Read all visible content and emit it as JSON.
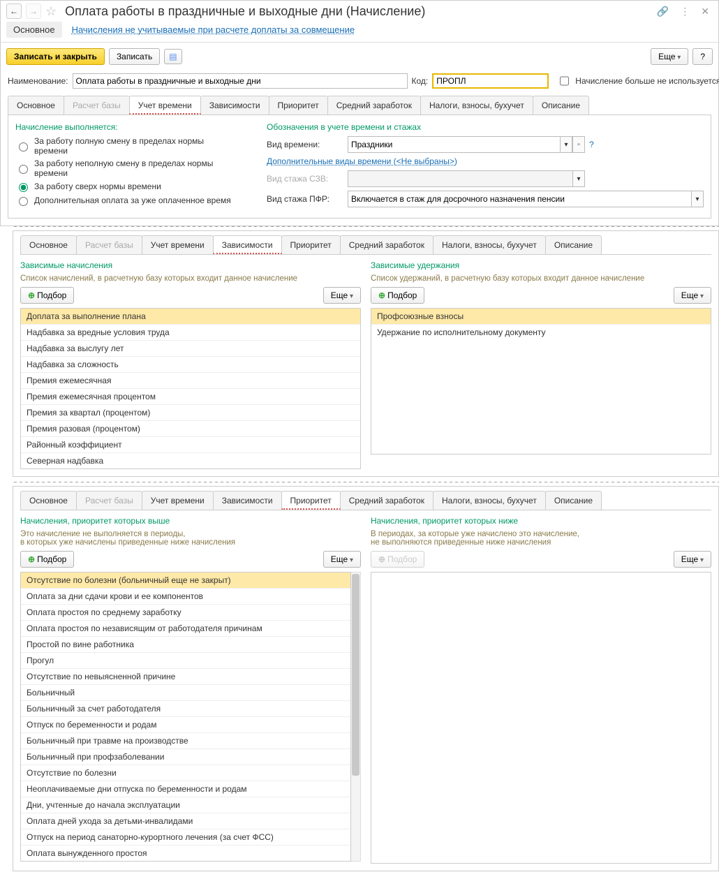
{
  "header": {
    "title": "Оплата работы в праздничные и выходные дни (Начисление)"
  },
  "subnav": {
    "main": "Основное",
    "link": "Начисления не учитываемые при расчете доплаты за совмещение"
  },
  "toolbar": {
    "save_close": "Записать и закрыть",
    "save": "Записать",
    "more": "Еще",
    "help": "?"
  },
  "form": {
    "name_label": "Наименование:",
    "name_value": "Оплата работы в праздничные и выходные дни",
    "code_label": "Код:",
    "code_value": "ПРОПЛ",
    "not_used_label": "Начисление больше не используется"
  },
  "main_tabs": {
    "t1": "Основное",
    "t2": "Расчет базы",
    "t3": "Учет времени",
    "t4": "Зависимости",
    "t5": "Приоритет",
    "t6": "Средний заработок",
    "t7": "Налоги, взносы, бухучет",
    "t8": "Описание"
  },
  "time_tab": {
    "left_title": "Начисление выполняется:",
    "r1": "За работу полную смену в пределах нормы времени",
    "r2": "За работу неполную смену в пределах нормы времени",
    "r3": "За работу сверх нормы времени",
    "r4": "Дополнительная оплата за уже оплаченное время",
    "right_title": "Обозначения в учете времени и стажах",
    "f1_label": "Вид времени:",
    "f1_value": "Праздники",
    "extra_link": "Дополнительные виды времени (<Не выбраны>)",
    "f2_label": "Вид стажа СЗВ:",
    "f2_value": "",
    "f3_label": "Вид стажа ПФР:",
    "f3_value": "Включается в стаж для досрочного назначения пенсии"
  },
  "deps_panel": {
    "left_title": "Зависимые начисления",
    "left_hint": "Список начислений, в расчетную базу которых входит данное начисление",
    "right_title": "Зависимые удержания",
    "right_hint": "Список удержаний, в расчетную базу которых входит данное начисление",
    "pick": "Подбор",
    "more": "Еще",
    "left_rows": [
      "Доплата за выполнение плана",
      "Надбавка за вредные условия труда",
      "Надбавка за выслугу лет",
      "Надбавка за сложность",
      "Премия ежемесячная",
      "Премия ежемесячная процентом",
      "Премия за квартал (процентом)",
      "Премия разовая (процентом)",
      "Районный коэффициент",
      "Северная надбавка"
    ],
    "right_rows": [
      "Профсоюзные взносы",
      "Удержание по исполнительному документу"
    ]
  },
  "prio_panel": {
    "left_title": "Начисления, приоритет которых выше",
    "left_hint1": "Это начисление не выполняется в периоды,",
    "left_hint2": "в которых уже начислены приведенные ниже начисления",
    "right_title": "Начисления, приоритет которых ниже",
    "right_hint1": "В периодах, за которые уже начислено это начисление,",
    "right_hint2": "не выполняются приведенные ниже начисления",
    "pick": "Подбор",
    "more": "Еще",
    "left_rows": [
      "Отсутствие по болезни (больничный еще не закрыт)",
      "Оплата за дни сдачи крови и ее компонентов",
      "Оплата простоя по среднему заработку",
      "Оплата простоя по независящим от работодателя причинам",
      "Простой по вине работника",
      "Прогул",
      "Отсутствие по невыясненной причине",
      "Больничный",
      "Больничный за счет работодателя",
      "Отпуск по беременности и родам",
      "Больничный при травме на производстве",
      "Больничный при профзаболевании",
      "Отсутствие по болезни",
      "Неоплачиваемые дни отпуска по беременности и родам",
      "Дни, учтенные до начала эксплуатации",
      "Оплата дней ухода за детьми-инвалидами",
      "Отпуск на период санаторно-курортного лечения (за счет ФСС)",
      "Оплата вынужденного простоя"
    ]
  }
}
